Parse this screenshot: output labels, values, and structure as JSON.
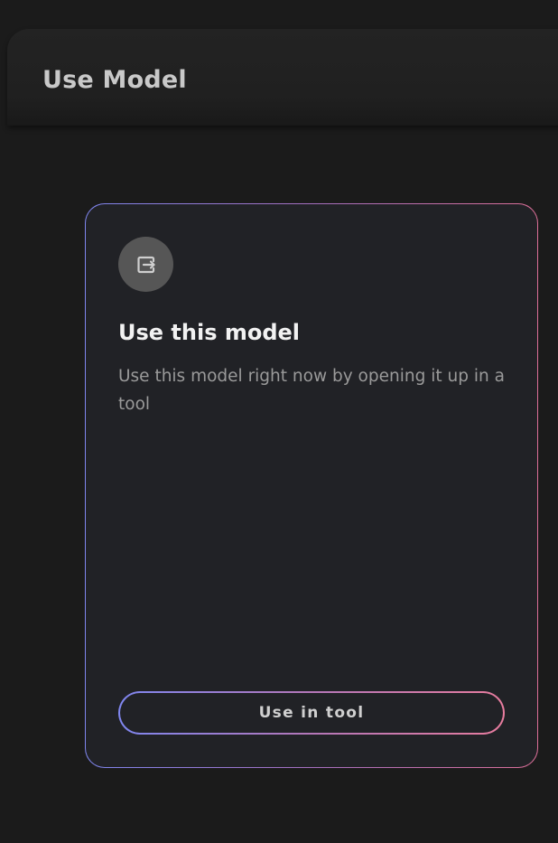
{
  "header": {
    "title": "Use Model"
  },
  "card": {
    "icon": "open-in-tool-icon",
    "title": "Use this model",
    "description": "Use this model right now by opening it up in a tool",
    "button_label": "Use in tool"
  },
  "colors": {
    "background": "#1b1b1b",
    "card_background": "#212226",
    "gradient_start": "#7f86ef",
    "gradient_end": "#dc6f98"
  }
}
